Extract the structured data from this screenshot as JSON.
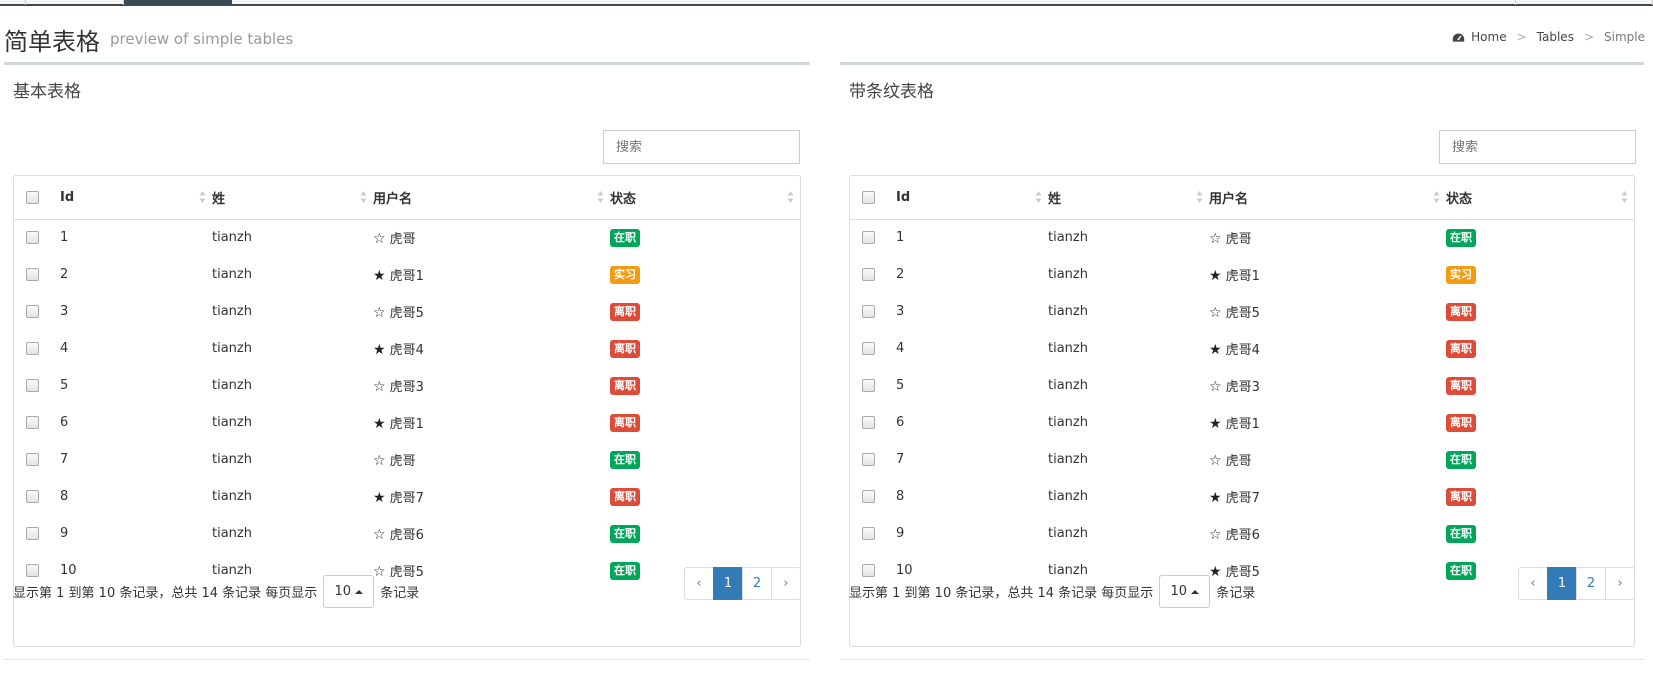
{
  "page": {
    "title": "简单表格",
    "subtitle": "preview of simple tables"
  },
  "breadcrumb": {
    "home": "Home",
    "tables": "Tables",
    "current": "Simple"
  },
  "colors": {
    "active": "#00a65a",
    "intern": "#f39c12",
    "left": "#dd4b39",
    "primary": "#337ab7"
  },
  "left_table": {
    "title": "基本表格",
    "search_placeholder": "搜索",
    "headers": [
      "Id",
      "姓",
      "用户名",
      "状态"
    ],
    "rows": [
      {
        "id": "1",
        "last": "tianzh",
        "star": "☆",
        "user": "虎哥",
        "status": "在职",
        "status_color": "#00a65a"
      },
      {
        "id": "2",
        "last": "tianzh",
        "star": "★",
        "user": "虎哥1",
        "status": "实习",
        "status_color": "#f39c12"
      },
      {
        "id": "3",
        "last": "tianzh",
        "star": "☆",
        "user": "虎哥5",
        "status": "离职",
        "status_color": "#dd4b39"
      },
      {
        "id": "4",
        "last": "tianzh",
        "star": "★",
        "user": "虎哥4",
        "status": "离职",
        "status_color": "#dd4b39"
      },
      {
        "id": "5",
        "last": "tianzh",
        "star": "☆",
        "user": "虎哥3",
        "status": "离职",
        "status_color": "#dd4b39"
      },
      {
        "id": "6",
        "last": "tianzh",
        "star": "★",
        "user": "虎哥1",
        "status": "离职",
        "status_color": "#dd4b39"
      },
      {
        "id": "7",
        "last": "tianzh",
        "star": "☆",
        "user": "虎哥",
        "status": "在职",
        "status_color": "#00a65a"
      },
      {
        "id": "8",
        "last": "tianzh",
        "star": "★",
        "user": "虎哥7",
        "status": "离职",
        "status_color": "#dd4b39"
      },
      {
        "id": "9",
        "last": "tianzh",
        "star": "☆",
        "user": "虎哥6",
        "status": "在职",
        "status_color": "#00a65a"
      },
      {
        "id": "10",
        "last": "tianzh",
        "star": "☆",
        "user": "虎哥5",
        "status": "在职",
        "status_color": "#00a65a"
      }
    ],
    "footer": {
      "summary": "显示第 1 到第 10 条记录，总共 14 条记录 每页显示",
      "page_size": "10",
      "suffix": "条记录",
      "prev": "‹",
      "pages": [
        "1",
        "2"
      ],
      "next": "›"
    }
  },
  "right_table": {
    "title": "带条纹表格",
    "search_placeholder": "搜索",
    "headers": [
      "Id",
      "姓",
      "用户名",
      "状态"
    ],
    "rows": [
      {
        "id": "1",
        "last": "tianzh",
        "star": "☆",
        "user": "虎哥",
        "status": "在职",
        "status_color": "#00a65a"
      },
      {
        "id": "2",
        "last": "tianzh",
        "star": "★",
        "user": "虎哥1",
        "status": "实习",
        "status_color": "#f39c12"
      },
      {
        "id": "3",
        "last": "tianzh",
        "star": "☆",
        "user": "虎哥5",
        "status": "离职",
        "status_color": "#dd4b39"
      },
      {
        "id": "4",
        "last": "tianzh",
        "star": "★",
        "user": "虎哥4",
        "status": "离职",
        "status_color": "#dd4b39"
      },
      {
        "id": "5",
        "last": "tianzh",
        "star": "☆",
        "user": "虎哥3",
        "status": "离职",
        "status_color": "#dd4b39"
      },
      {
        "id": "6",
        "last": "tianzh",
        "star": "★",
        "user": "虎哥1",
        "status": "离职",
        "status_color": "#dd4b39"
      },
      {
        "id": "7",
        "last": "tianzh",
        "star": "☆",
        "user": "虎哥",
        "status": "在职",
        "status_color": "#00a65a"
      },
      {
        "id": "8",
        "last": "tianzh",
        "star": "★",
        "user": "虎哥7",
        "status": "离职",
        "status_color": "#dd4b39"
      },
      {
        "id": "9",
        "last": "tianzh",
        "star": "☆",
        "user": "虎哥6",
        "status": "在职",
        "status_color": "#00a65a"
      },
      {
        "id": "10",
        "last": "tianzh",
        "star": "★",
        "user": "虎哥5",
        "status": "在职",
        "status_color": "#00a65a"
      }
    ],
    "footer": {
      "summary": "显示第 1 到第 10 条记录，总共 14 条记录 每页显示",
      "page_size": "10",
      "suffix": "条记录",
      "prev": "‹",
      "pages": [
        "1",
        "2"
      ],
      "next": "›"
    }
  }
}
